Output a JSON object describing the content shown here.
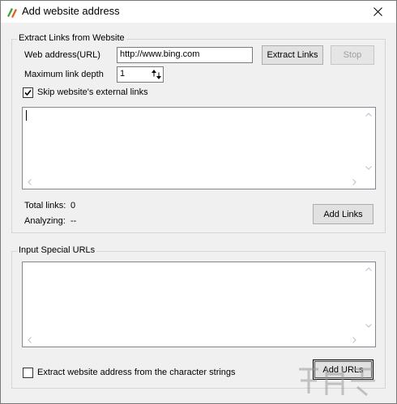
{
  "window": {
    "title": "Add website address",
    "close_glyph": "✕"
  },
  "extract_group": {
    "legend": "Extract Links from Website",
    "web_address_label": "Web address(URL)",
    "web_address_value": "http://www.bing.com",
    "max_depth_label": "Maximum link depth",
    "max_depth_value": "1",
    "extract_button": "Extract Links",
    "stop_button": "Stop",
    "skip_external_label": "Skip website's external links",
    "skip_external_checked": true,
    "total_links_label": "Total links:",
    "total_links_value": "0",
    "analyzing_label": "Analyzing:",
    "analyzing_value": "--",
    "add_links_button": "Add Links"
  },
  "special_group": {
    "legend": "Input Special URLs",
    "extract_strings_label": "Extract website address from the character strings",
    "extract_strings_checked": false,
    "add_urls_button": "Add URLs"
  },
  "icons": {
    "app": "app-logo-icon",
    "close": "close-icon",
    "spinner": "spinner-arrows-icon",
    "check": "checkmark-icon"
  },
  "colors": {
    "dialog_bg": "#f0f0f0",
    "border": "#d5d5d5",
    "button_bg": "#e1e1e1",
    "disabled_text": "#a0a0a0"
  }
}
